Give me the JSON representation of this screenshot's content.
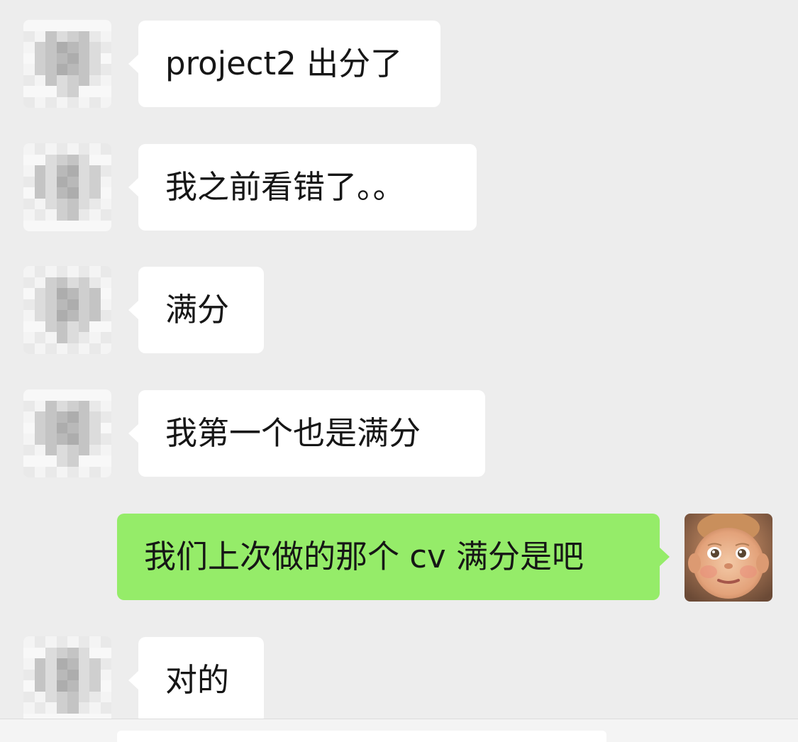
{
  "messages": [
    {
      "direction": "incoming",
      "text": "project2 出分了",
      "avatar": "pixelated-avatar-icon"
    },
    {
      "direction": "incoming",
      "text": "我之前看错了。。",
      "avatar": "pixelated-avatar-icon"
    },
    {
      "direction": "incoming",
      "text": "满分",
      "avatar": "pixelated-avatar-icon"
    },
    {
      "direction": "incoming",
      "text": "我第一个也是满分",
      "avatar": "pixelated-avatar-icon"
    },
    {
      "direction": "outgoing",
      "text": "我们上次做的那个 cv 满分是吧",
      "avatar": "baby-face-avatar-icon"
    },
    {
      "direction": "incoming",
      "text": "对的",
      "avatar": "pixelated-avatar-icon"
    }
  ],
  "colors": {
    "background": "#ededed",
    "incoming_bubble": "#ffffff",
    "outgoing_bubble": "#95ec69",
    "text": "#161616"
  }
}
